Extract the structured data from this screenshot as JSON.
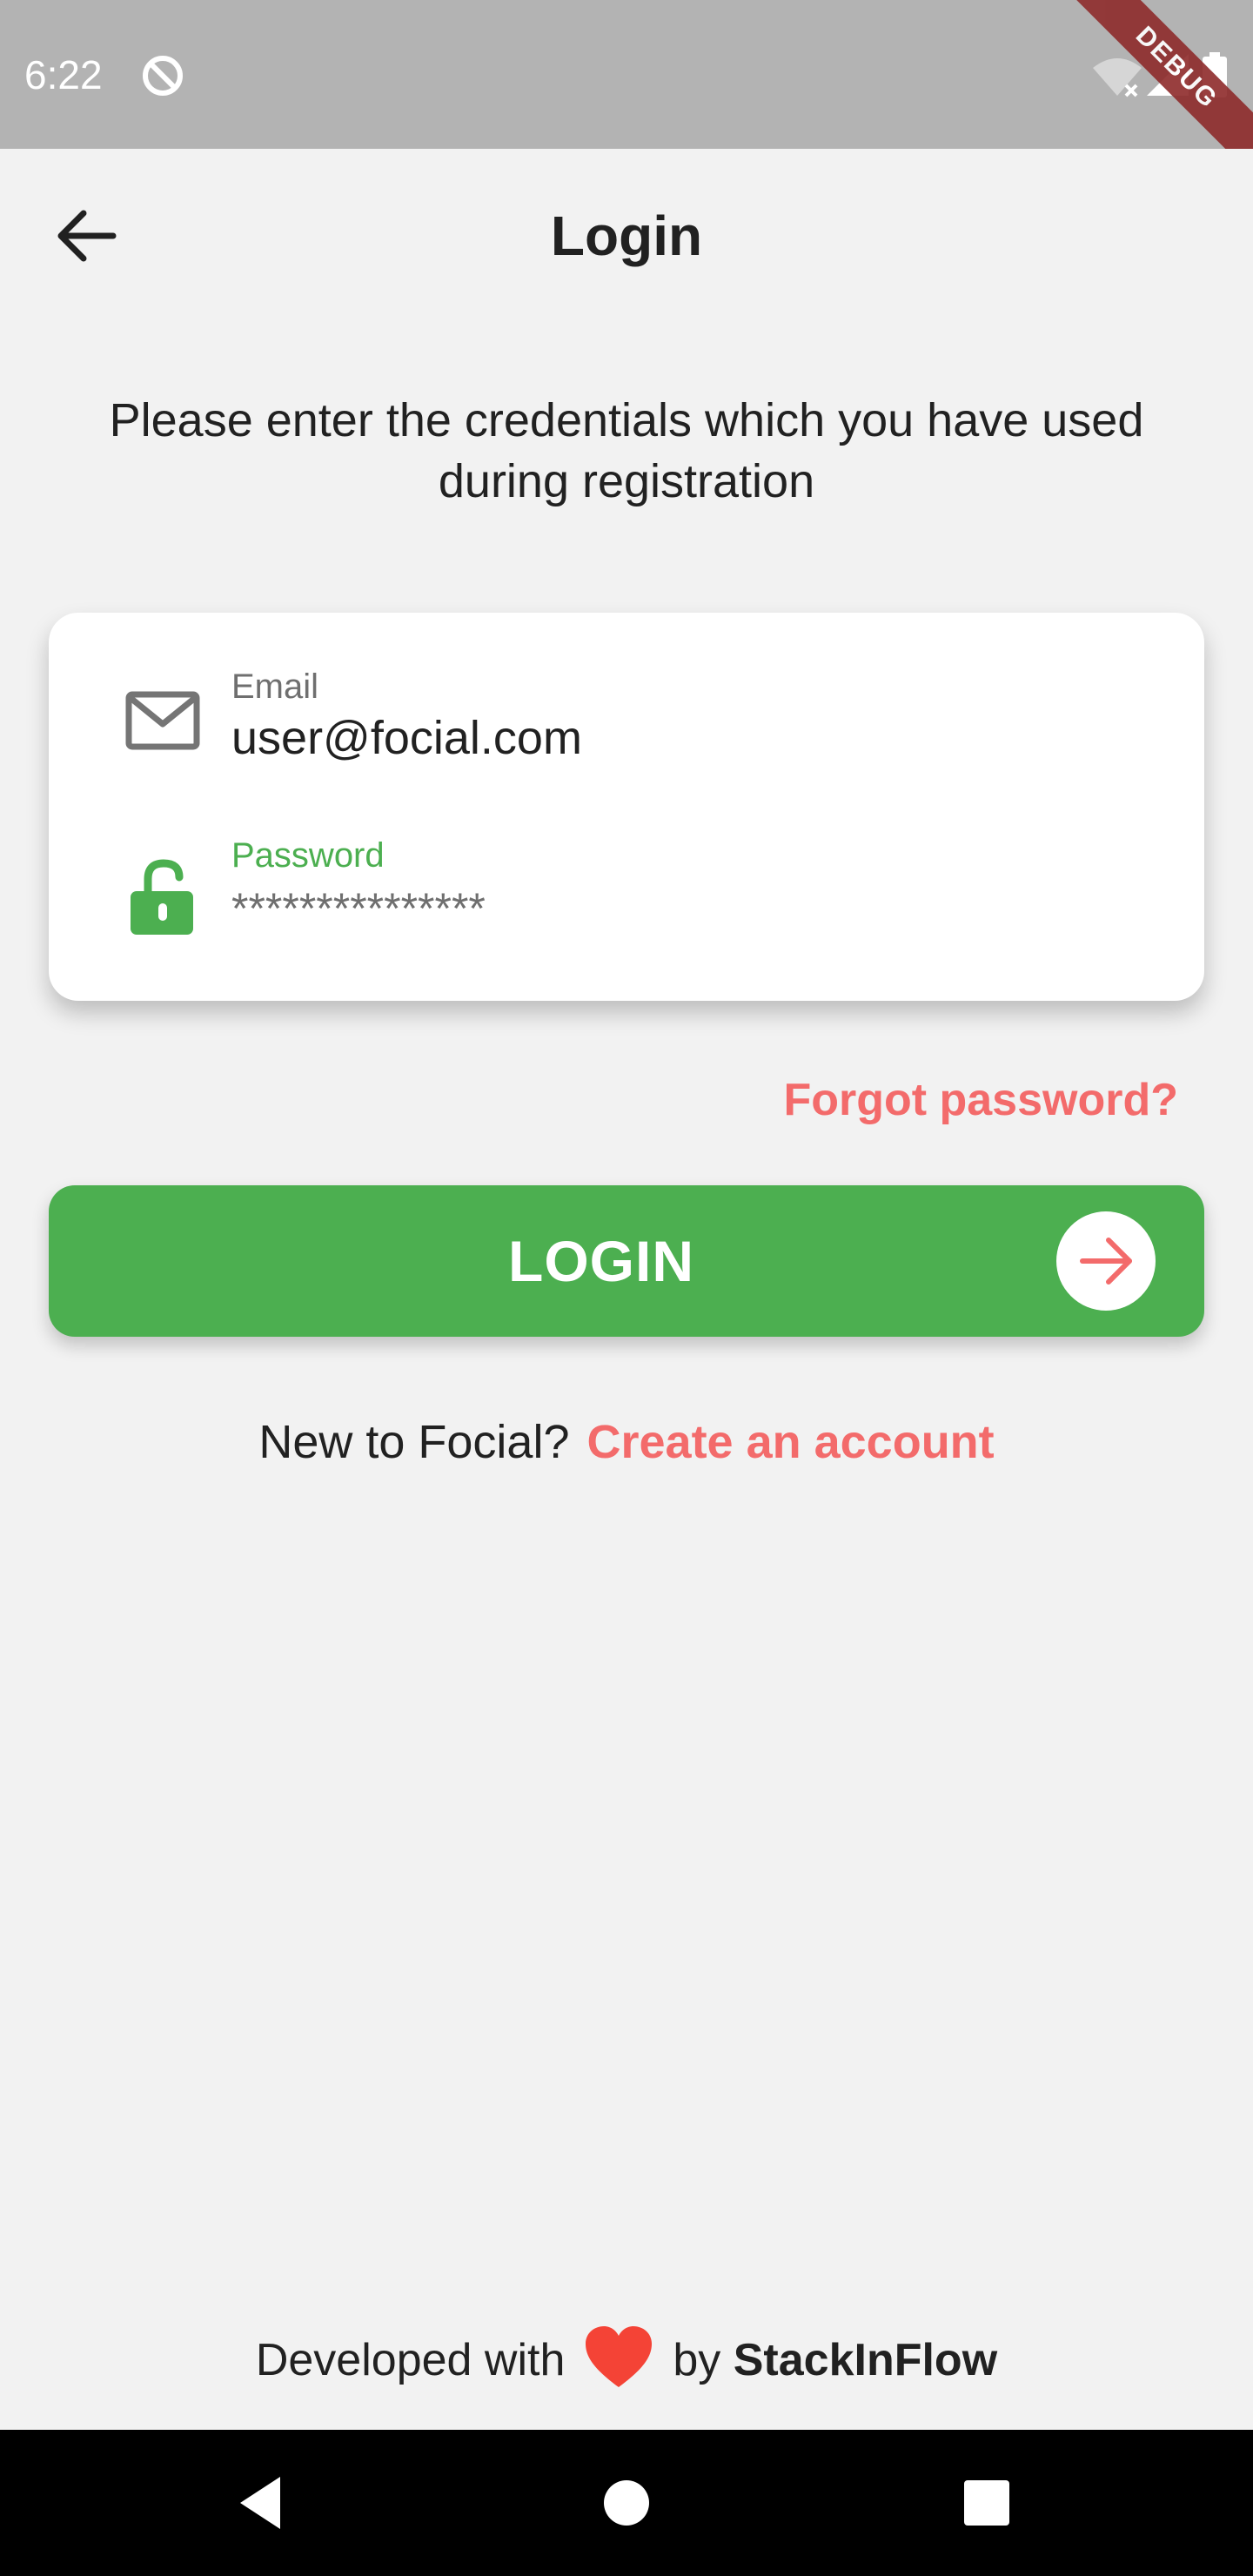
{
  "status_bar": {
    "time": "6:22",
    "icons": [
      "location-off-icon",
      "wifi-off-icon",
      "cell-signal-icon",
      "battery-icon"
    ],
    "debug_label": "DEBUG"
  },
  "app_bar": {
    "title": "Login",
    "back_icon": "arrow-back-icon"
  },
  "subtitle": "Please enter the credentials which you have used during registration",
  "form": {
    "email": {
      "label": "Email",
      "value": "user@focial.com",
      "icon": "mail-icon"
    },
    "password": {
      "label": "Password",
      "value": "***************",
      "icon": "lock-open-icon"
    }
  },
  "forgot_password": "Forgot password?",
  "login_button": {
    "label": "LOGIN",
    "icon": "arrow-forward-icon"
  },
  "signup": {
    "prompt": "New to Focial?",
    "link": "Create an account"
  },
  "footer": {
    "prefix": "Developed with",
    "icon": "heart-icon",
    "by": "by",
    "brand": "StackInFlow"
  },
  "nav_bar": {
    "buttons": [
      "back-triangle-icon",
      "home-circle-icon",
      "recents-square-icon"
    ]
  },
  "colors": {
    "accent_green": "#4caf50",
    "accent_red": "#f36b6b",
    "background": "#f2f2f2",
    "status_bar": "#b3b3b3"
  }
}
